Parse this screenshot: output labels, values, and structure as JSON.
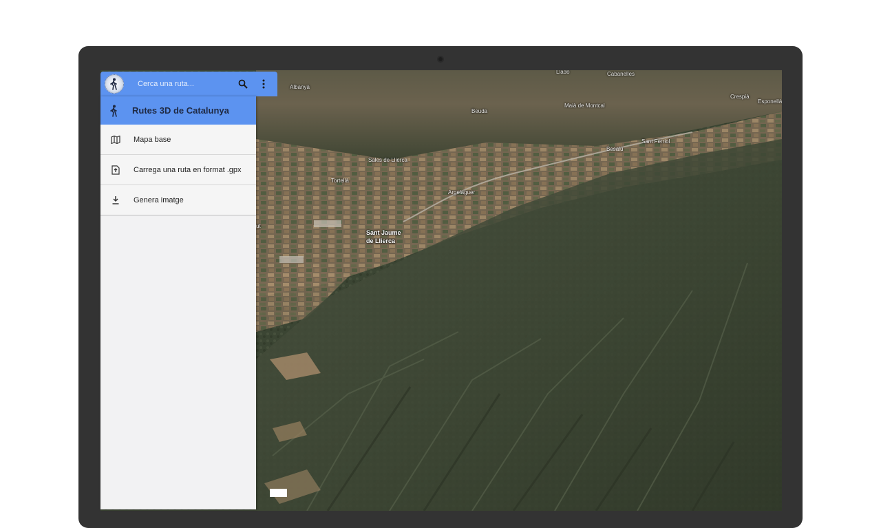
{
  "app": {
    "search_placeholder": "Cerca una ruta...",
    "sidebar_title": "Rutes 3D de Catalunya"
  },
  "menu": [
    {
      "label": "Mapa base",
      "icon": "map-icon"
    },
    {
      "label": "Carrega una ruta en format .gpx",
      "icon": "file-upload-icon"
    },
    {
      "label": "Genera imatge",
      "icon": "download-icon"
    }
  ],
  "map": {
    "places": {
      "albanya": "Albanyà",
      "llado": "Lladó",
      "cabanelles": "Cabanelles",
      "beuda": "Beuda",
      "maia": "Maià de Montcal",
      "crespia": "Crespià",
      "esponella": "Esponellà",
      "besalu": "Besalú",
      "sant_ferriol": "Sant Ferriol",
      "sales": "Sales de Llierca",
      "tortella": "Tortellà",
      "argelaguer": "Argelaguer",
      "sant_jaume_1": "Sant Jaume",
      "sant_jaume_2": "de Llierca",
      "ut": "ut"
    }
  },
  "colors": {
    "accent": "#5c93f0",
    "device": "#333333",
    "sidebar_bg": "#f2f2f3"
  }
}
